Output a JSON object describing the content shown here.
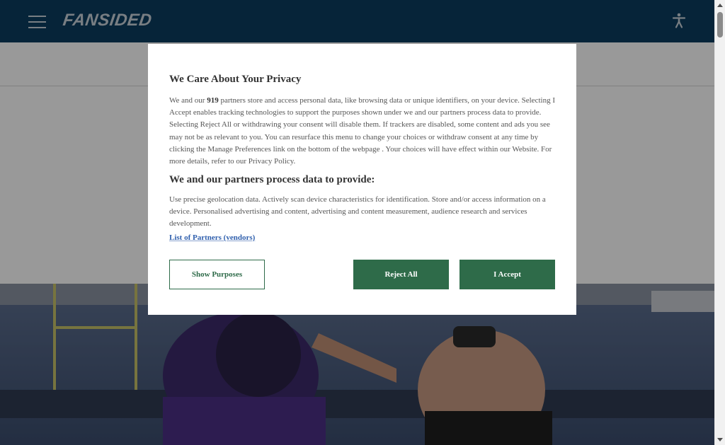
{
  "header": {
    "logo_text": "FANSIDED",
    "menu_icon": "hamburger-menu-icon",
    "accessibility_icon": "accessibility-person-icon",
    "bg_color": "#0b3d60"
  },
  "consent": {
    "title": "We Care About Your Privacy",
    "intro_before": "We and our ",
    "partner_count": "919",
    "intro_after": " partners store and access personal data, like browsing data or unique identifiers, on your device. Selecting I Accept enables tracking technologies to support the purposes shown under we and our partners process data to provide. Selecting Reject All or withdrawing your consent will disable them. If trackers are disabled, some content and ads you see may not be as relevant to you. You can resurface this menu to change your choices or withdraw consent at any time by clicking the Manage Preferences link on the bottom of the webpage . Your choices will have effect within our Website. For more details, refer to our Privacy Policy.",
    "subtitle": "We and our partners process data to provide:",
    "purposes_text": "Use precise geolocation data. Actively scan device characteristics for identification. Store and/or access information on a device. Personalised advertising and content, advertising and content measurement, audience research and services development.",
    "partners_link": "List of Partners (vendors)",
    "buttons": {
      "show_purposes": "Show Purposes",
      "reject_all": "Reject All",
      "accept": "I Accept"
    },
    "accent_color": "#2e6b49"
  }
}
